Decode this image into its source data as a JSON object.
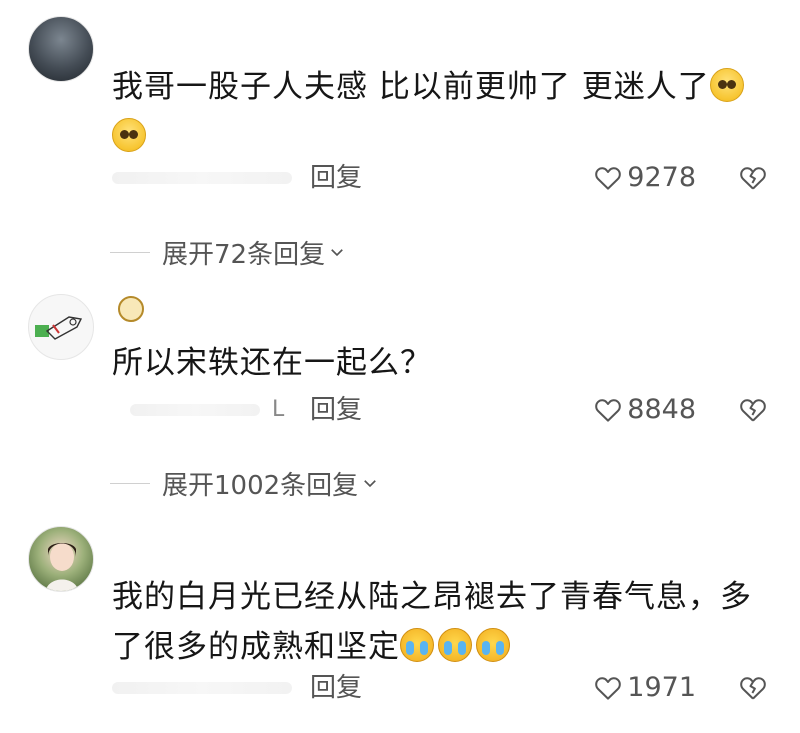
{
  "comments": [
    {
      "text": "我哥一股子人夫感 比以前更帅了 更迷人了",
      "emojis": [
        "pleading-face-icon",
        "pleading-face-icon"
      ],
      "reply_label": "回复",
      "likes": "9278",
      "expand_label": "展开72条回复"
    },
    {
      "text": "所以宋轶还在一起么？",
      "name_fragment": "L",
      "reply_label": "回复",
      "likes": "8848",
      "expand_label": "展开1002条回复"
    },
    {
      "text": "我的白月光已经从陆之昂褪去了青春气息，多了很多的成熟和坚定",
      "emojis": [
        "crying-face-icon",
        "crying-face-icon",
        "crying-face-icon"
      ],
      "reply_label": "回复",
      "likes": "1971"
    }
  ],
  "colors": {
    "text": "#161616",
    "meta": "#555555",
    "divider": "#d0d0d0"
  }
}
